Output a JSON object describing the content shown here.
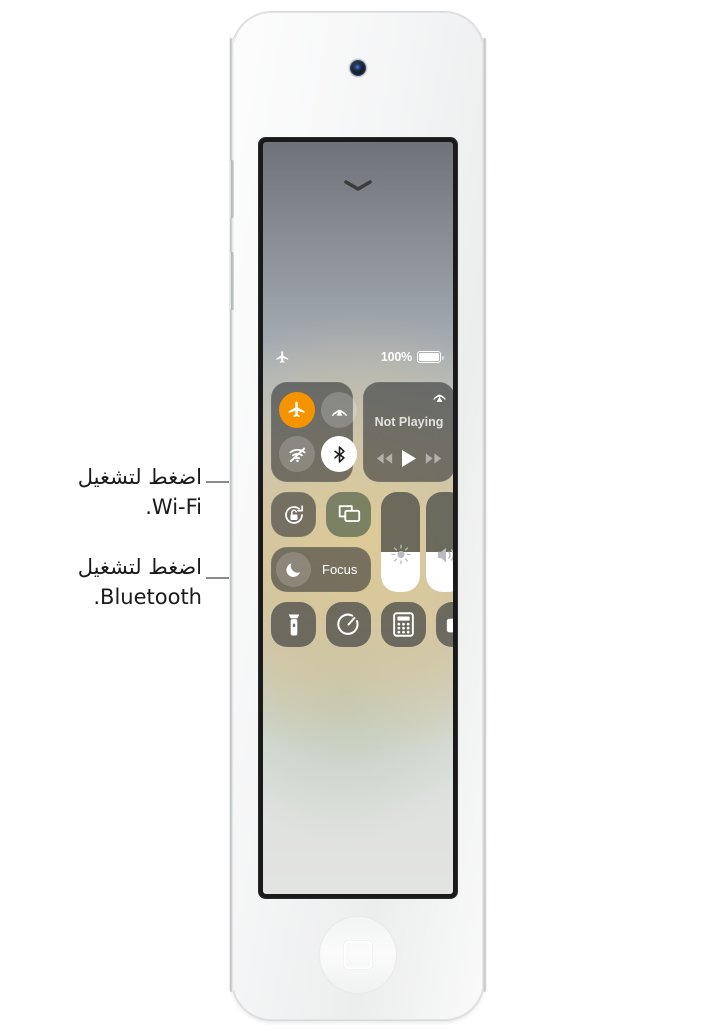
{
  "callouts": [
    {
      "id": "wifi",
      "line1": "اضغط لتشغيل",
      "line2": "Wi-Fi.",
      "target": "wifi-toggle"
    },
    {
      "id": "bluetooth",
      "line1": "اضغط لتشغيل",
      "line2": "Bluetooth.",
      "target": "bluetooth-toggle"
    }
  ],
  "device": {
    "kind": "ipod-touch",
    "body_color": "#f6f7f7"
  },
  "screen": {
    "status_bar": {
      "airplane_icon": "airplane-icon",
      "battery_percent": "100%",
      "battery_level": 100
    },
    "chevron_icon": "chevron-down-icon",
    "control_center": {
      "connectivity": {
        "toggles": [
          {
            "name": "airplane-mode",
            "icon": "airplane-icon",
            "state": "on",
            "color": "#f59300"
          },
          {
            "name": "airdrop",
            "icon": "airdrop-icon",
            "state": "off",
            "color": "rgba(255,255,255,0.20)"
          },
          {
            "name": "wifi",
            "icon": "wifi-off-icon",
            "state": "off",
            "color": "rgba(255,255,255,0.18)"
          },
          {
            "name": "bluetooth",
            "icon": "bluetooth-icon",
            "state": "on",
            "color": "#ffffff"
          }
        ]
      },
      "media": {
        "title": "Not Playing",
        "airplay_icon": "airplay-icon",
        "controls": [
          {
            "name": "rewind-button",
            "icon": "rewind-icon"
          },
          {
            "name": "play-button",
            "icon": "play-icon"
          },
          {
            "name": "fastforward-button",
            "icon": "fast-forward-icon"
          }
        ]
      },
      "rotation_lock": {
        "icon": "rotation-lock-icon",
        "state": "off"
      },
      "screen_mirroring": {
        "icon": "screen-mirroring-icon",
        "state": "off"
      },
      "focus": {
        "label": "Focus",
        "icon": "moon-icon",
        "state": "off"
      },
      "sliders": [
        {
          "name": "brightness-slider",
          "icon": "brightness-icon",
          "value": 40
        },
        {
          "name": "volume-slider",
          "icon": "volume-icon",
          "value": 40
        }
      ],
      "apps": [
        {
          "name": "flashlight",
          "icon": "flashlight-icon"
        },
        {
          "name": "timer",
          "icon": "timer-icon"
        },
        {
          "name": "calculator",
          "icon": "calculator-icon"
        },
        {
          "name": "camera",
          "icon": "camera-icon"
        }
      ]
    }
  }
}
